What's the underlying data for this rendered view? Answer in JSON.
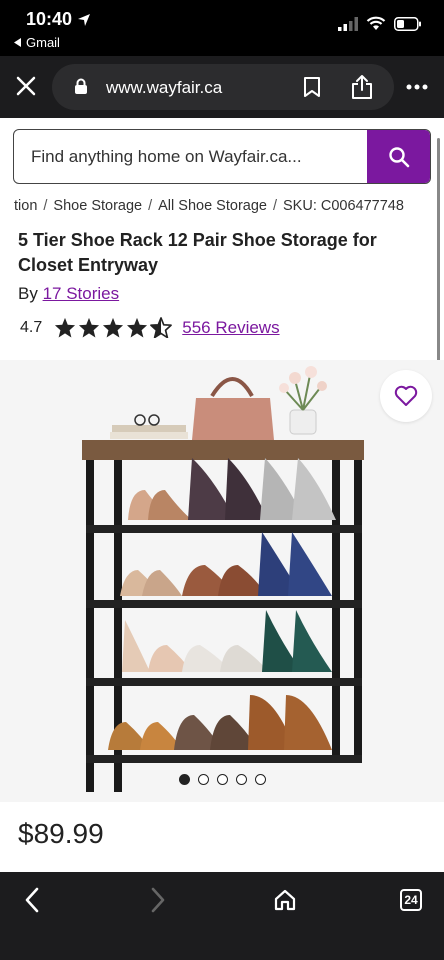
{
  "status_bar": {
    "time": "10:40",
    "back_app": "Gmail"
  },
  "browser": {
    "url": "www.wayfair.ca"
  },
  "search": {
    "placeholder": "Find anything home on Wayfair.ca..."
  },
  "breadcrumb": [
    "tion",
    "Shoe Storage",
    "All Shoe Storage",
    "SKU: C006477748"
  ],
  "product": {
    "title": "5 Tier Shoe Rack 12 Pair Shoe Storage for Closet Entryway",
    "by_label": "By",
    "brand": "17 Stories",
    "rating": "4.7",
    "stars": 4.7,
    "reviews": "556 Reviews",
    "price": "$89.99",
    "image_count": 5,
    "active_image": 0
  },
  "toolbar": {
    "tab_count": "24"
  },
  "colors": {
    "accent": "#7b189f",
    "chrome": "#1c1c1e"
  }
}
